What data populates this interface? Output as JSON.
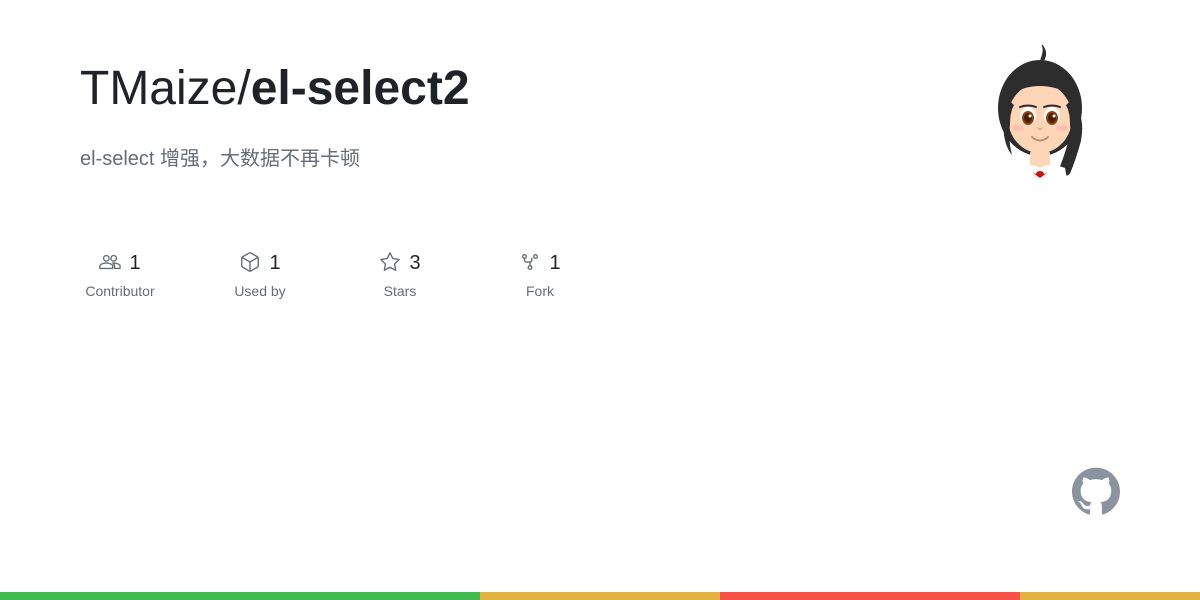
{
  "repo": {
    "owner": "TMaize",
    "name": "el-select2",
    "description": "el-select 增强，大数据不再卡顿"
  },
  "stats": [
    {
      "id": "contributor",
      "icon": "contributor-icon",
      "count": "1",
      "label": "Contributor"
    },
    {
      "id": "used-by",
      "icon": "package-icon",
      "count": "1",
      "label": "Used by"
    },
    {
      "id": "stars",
      "icon": "star-icon",
      "count": "3",
      "label": "Stars"
    },
    {
      "id": "fork",
      "icon": "fork-icon",
      "count": "1",
      "label": "Fork"
    }
  ],
  "bottom_bar": {
    "segments": [
      {
        "color": "#3fb950",
        "width": "40%"
      },
      {
        "color": "#e3b341",
        "width": "20%"
      },
      {
        "color": "#f85149",
        "width": "25%"
      },
      {
        "color": "#e3b341",
        "width": "15%"
      }
    ]
  }
}
